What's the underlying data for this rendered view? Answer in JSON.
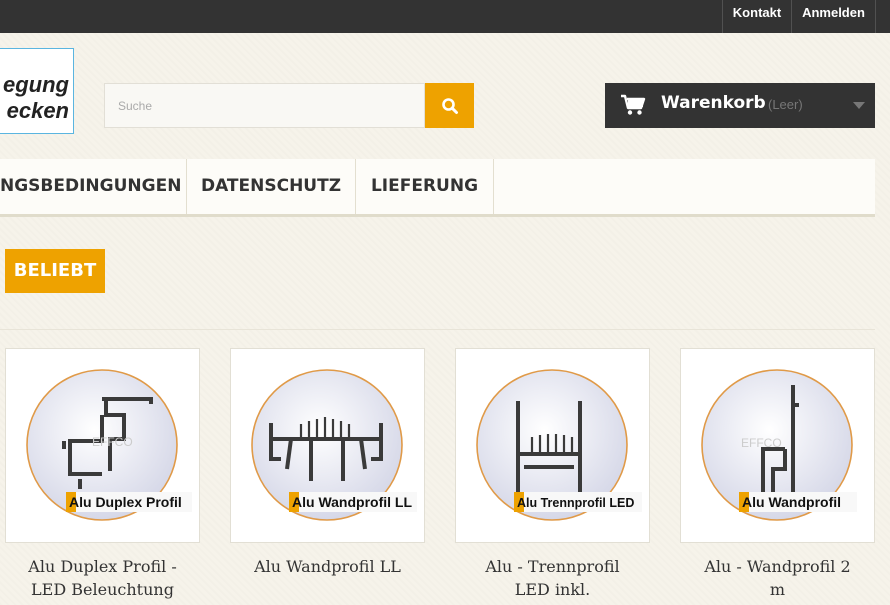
{
  "topbar": {
    "contact": "Kontakt",
    "login": "Anmelden"
  },
  "logo": {
    "line1": "egung",
    "line2": "ecken"
  },
  "search": {
    "placeholder": "Suche",
    "icon": "search-icon"
  },
  "cart": {
    "title": "Warenkorb",
    "status": "(Leer)",
    "icon": "shopping-cart-icon"
  },
  "menu": {
    "items": [
      {
        "label": "NGSBEDINGUNGEN"
      },
      {
        "label": "DATENSCHUTZ"
      },
      {
        "label": "LIEFERUNG"
      }
    ]
  },
  "section": {
    "tab": "BELIEBT"
  },
  "products": [
    {
      "name_line1": "Alu Duplex Profil -",
      "name_line2": "LED Beleuchtung",
      "image_label": "Alu Duplex Profil"
    },
    {
      "name_line1": "Alu Wandprofil LL",
      "name_line2": "",
      "image_label": "Alu Wandprofil LL"
    },
    {
      "name_line1": "Alu - Trennprofil",
      "name_line2": "LED inkl.",
      "image_label": "Alu Trennprofil LED"
    },
    {
      "name_line1": "Alu - Wandprofil 2",
      "name_line2": "m",
      "image_label": "Alu Wandprofil"
    }
  ],
  "colors": {
    "accent": "#eea200",
    "dark": "#333333"
  }
}
